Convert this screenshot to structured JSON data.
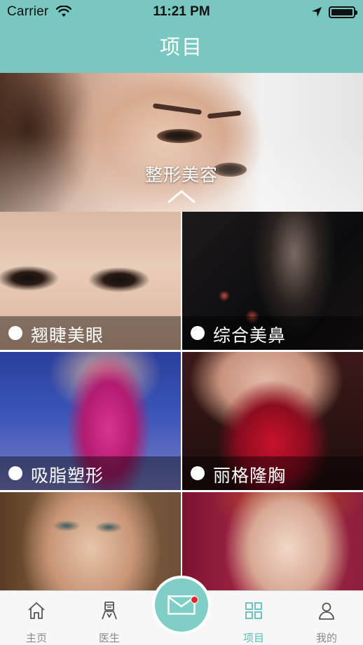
{
  "status_bar": {
    "carrier": "Carrier",
    "time": "11:21 PM",
    "icons": [
      "wifi-icon",
      "location-arrow-icon",
      "battery-icon"
    ]
  },
  "nav": {
    "title": "项目"
  },
  "banner": {
    "title": "整形美容",
    "collapse_icon": "chevron-up-icon"
  },
  "tiles": [
    {
      "label": "翘睫美眼"
    },
    {
      "label": "综合美鼻"
    },
    {
      "label": "吸脂塑形"
    },
    {
      "label": "丽格隆胸"
    }
  ],
  "tabbar": {
    "items": [
      {
        "label": "主页",
        "icon": "home-icon"
      },
      {
        "label": "医生",
        "icon": "doctor-icon"
      },
      {
        "label": "项目",
        "icon": "grid-icon",
        "active": true
      },
      {
        "label": "我的",
        "icon": "person-icon"
      }
    ],
    "center_icon": "mail-icon"
  },
  "colors": {
    "accent": "#78c8c1",
    "tab_active": "#5cbfb6",
    "tab_inactive": "#8a8a8a",
    "notification": "#e8222c"
  }
}
